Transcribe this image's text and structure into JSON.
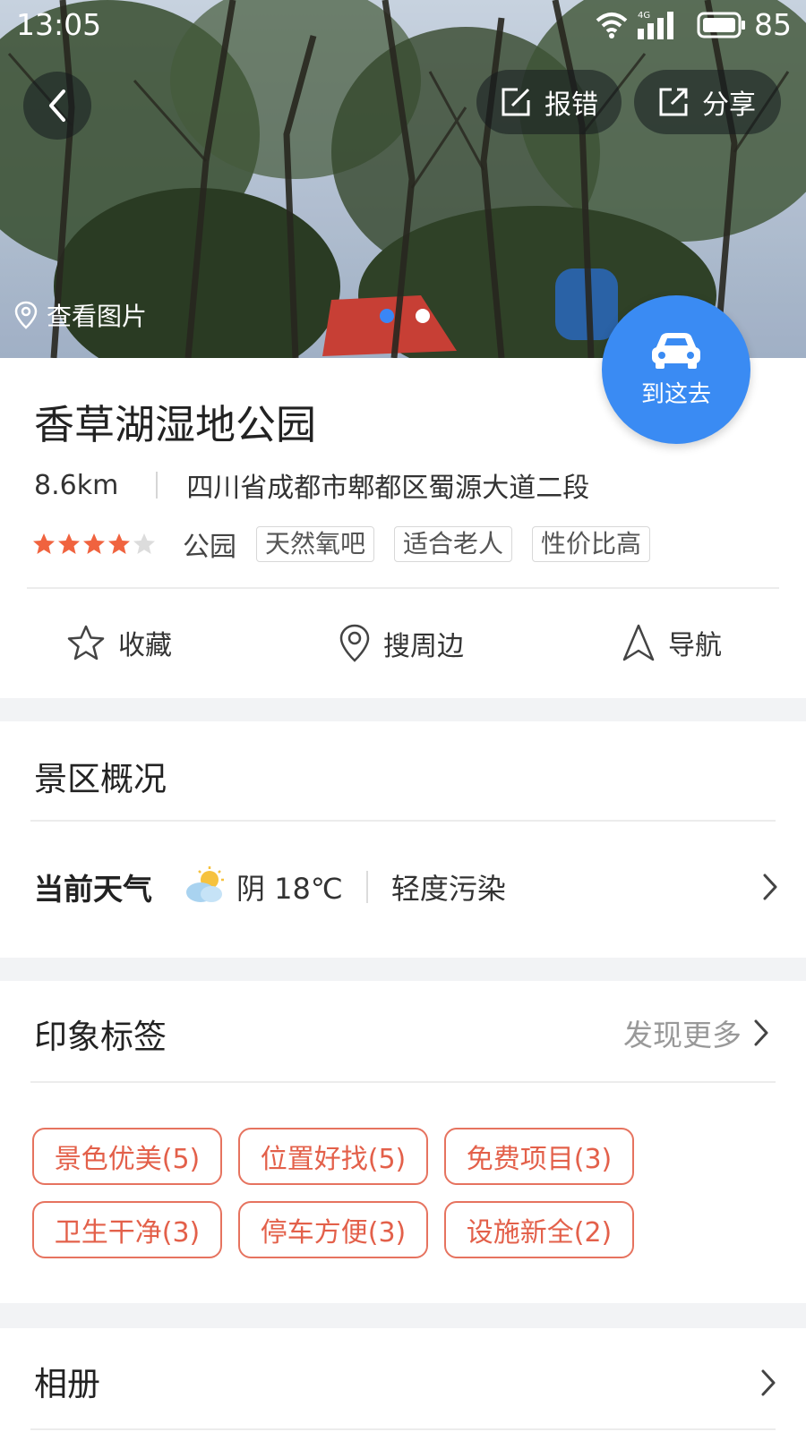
{
  "status_bar": {
    "time": "13:05",
    "network": "4G",
    "battery": "85"
  },
  "hero": {
    "report_label": "报错",
    "share_label": "分享",
    "view_photos_label": "查看图片",
    "carousel": {
      "count": 2,
      "active_index": 0
    }
  },
  "go_button": {
    "label": "到这去",
    "color": "#3a8bf3"
  },
  "place": {
    "name": "香草湖湿地公园",
    "distance": "8.6km",
    "address": "四川省成都市郫都区蜀源大道二段",
    "rating": 4,
    "rating_max": 5,
    "category": "公园",
    "feature_tags": [
      "天然氧吧",
      "适合老人",
      "性价比高"
    ]
  },
  "actions": {
    "favorite_label": "收藏",
    "nearby_label": "搜周边",
    "navigate_label": "导航"
  },
  "overview": {
    "title": "景区概况",
    "weather_label": "当前天气",
    "weather_icon": "cloudy-sun-icon",
    "weather_condition": "阴 18℃",
    "air_quality": "轻度污染"
  },
  "impressions": {
    "title": "印象标签",
    "more_label": "发现更多",
    "tags": [
      "景色优美(5)",
      "位置好找(5)",
      "免费项目(3)",
      "卫生干净(3)",
      "停车方便(3)",
      "设施新全(2)"
    ],
    "accent_color": "#e3604a"
  },
  "album": {
    "title": "相册"
  }
}
